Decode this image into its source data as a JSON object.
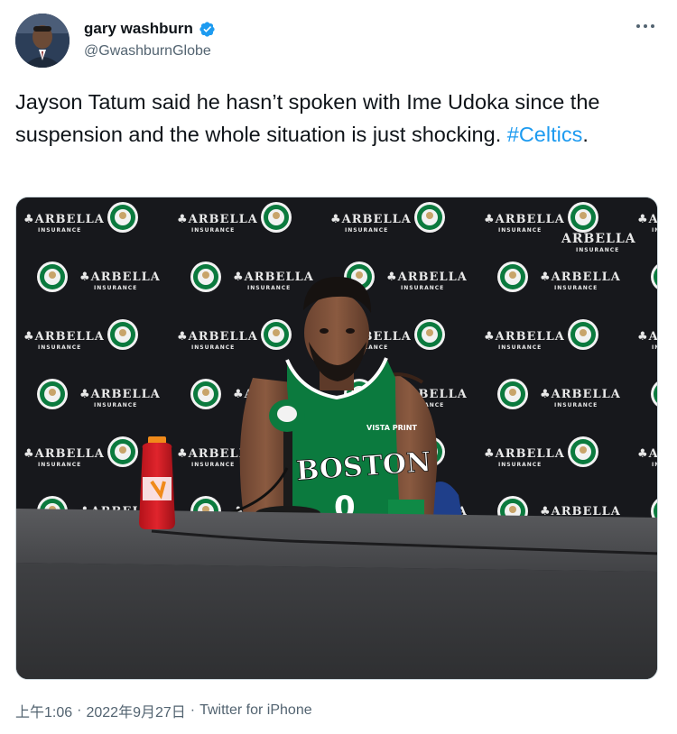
{
  "author": {
    "display_name": "gary washburn",
    "handle": "@GwashburnGlobe",
    "verified": true
  },
  "tweet": {
    "text_before_hashtag": "Jayson Tatum said he hasn’t spoken with Ime Udoka since the suspension and the whole situation is just shocking. ",
    "hashtag": "#Celtics",
    "text_after_hashtag": "."
  },
  "media": {
    "backdrop_sponsor": "ARBELLA",
    "backdrop_sponsor_sub": "INSURANCE",
    "jersey_text": "BOSTON",
    "jersey_patch": "VISTA PRINT",
    "jersey_number": "0"
  },
  "meta": {
    "time": "上午1:06",
    "separator": "·",
    "date": "2022年9月27日",
    "source": "Twitter for iPhone"
  },
  "colors": {
    "link": "#1d9bf0",
    "verified": "#1d9bf0",
    "secondary_text": "#536471",
    "celtics_green": "#0b7a3e"
  }
}
